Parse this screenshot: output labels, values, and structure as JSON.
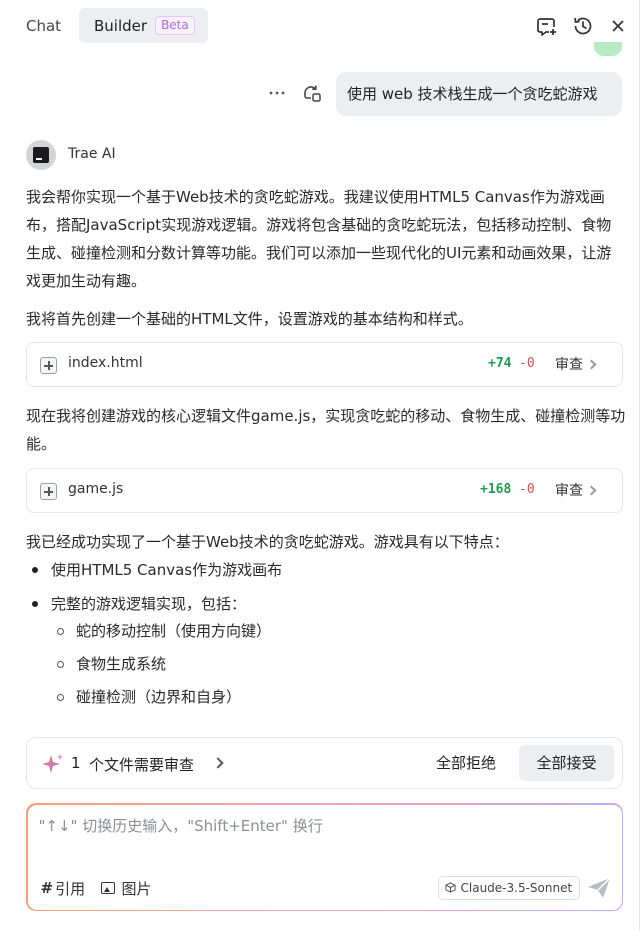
{
  "header": {
    "tab_chat": "Chat",
    "tab_builder": "Builder",
    "beta_badge": "Beta"
  },
  "user_message": {
    "text": "使用 web 技术栈生成一个贪吃蛇游戏"
  },
  "ai": {
    "name": "Trae AI",
    "intro": "我会帮你实现一个基于Web技术的贪吃蛇游戏。我建议使用HTML5 Canvas作为游戏画布，搭配JavaScript实现游戏逻辑。游戏将包含基础的贪吃蛇玩法，包括移动控制、食物生成、碰撞检测和分数计算等功能。我们可以添加一些现代化的UI元素和动画效果，让游戏更加生动有趣。",
    "step1": "我将首先创建一个基础的HTML文件，设置游戏的基本结构和样式。",
    "step2": "现在我将创建游戏的核心逻辑文件game.js，实现贪吃蛇的移动、食物生成、碰撞检测等功能。",
    "summary": "我已经成功实现了一个基于Web技术的贪吃蛇游戏。游戏具有以下特点：",
    "bullets": [
      "使用HTML5 Canvas作为游戏画布",
      "完整的游戏逻辑实现，包括："
    ],
    "sub_bullets": [
      "蛇的移动控制（使用方向键）",
      "食物生成系统",
      "碰撞检测（边界和自身）"
    ]
  },
  "files": [
    {
      "name": "index.html",
      "added": "+74",
      "removed": "-0",
      "review_label": "审查"
    },
    {
      "name": "game.js",
      "added": "+168",
      "removed": "-0",
      "review_label": "审查"
    }
  ],
  "review_bar": {
    "count": "1",
    "text": "个文件需要审查",
    "reject_all": "全部拒绝",
    "accept_all": "全部接受"
  },
  "input": {
    "placeholder": "\"↑↓\" 切换历史输入，\"Shift+Enter\" 换行",
    "ref_label": "引用",
    "image_label": "图片",
    "model": "Claude-3.5-Sonnet"
  },
  "colors": {
    "added": "#1e9c52",
    "removed": "#e04a4a",
    "beta": "#b16cd9"
  }
}
